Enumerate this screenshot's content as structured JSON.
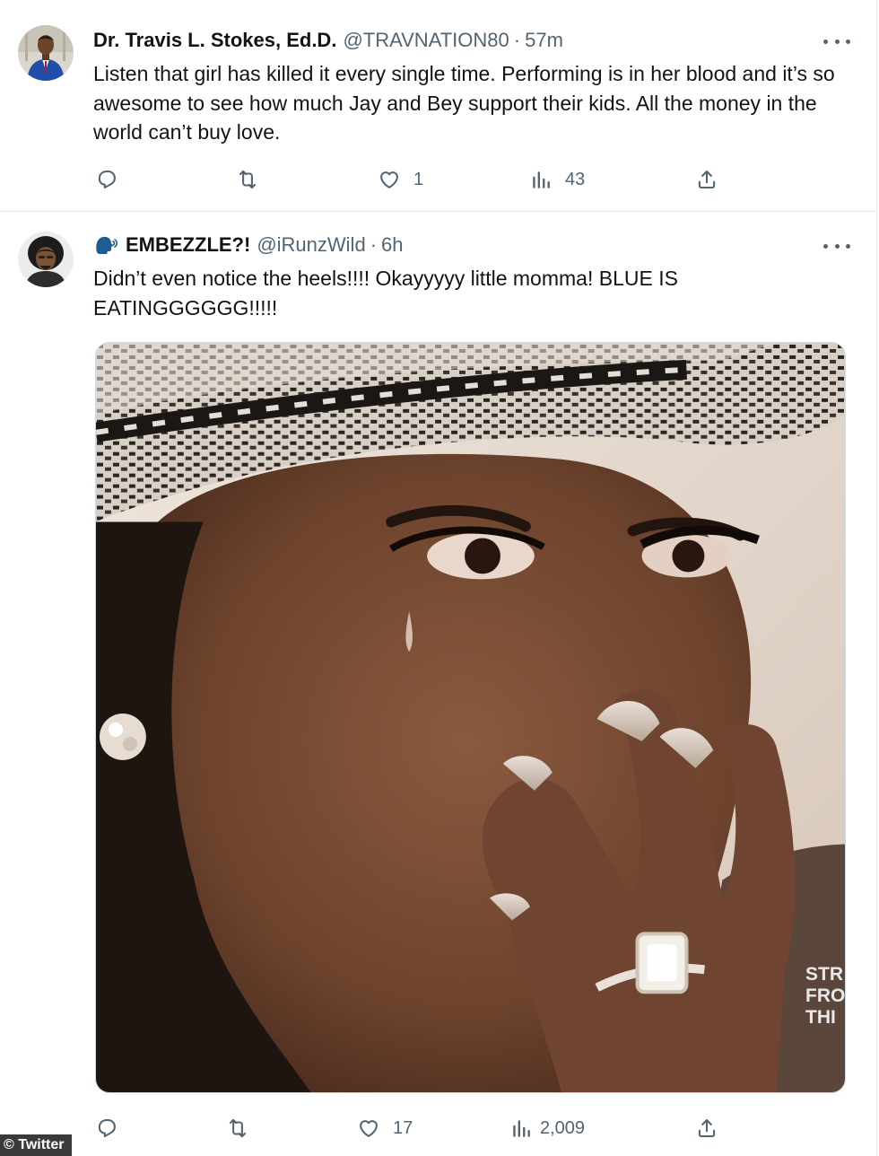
{
  "tweets": [
    {
      "display_name": "Dr. Travis L. Stokes, Ed.D.",
      "handle": "@TRAVNATION80",
      "separator": "·",
      "time": "57m",
      "text": "Listen that girl has killed it every single time. Performing is in her blood and it’s so awesome to see how much Jay and Bey support their kids. All the money in the world can’t buy love.",
      "actions": {
        "reply_count": "",
        "retweet_count": "",
        "like_count": "1",
        "views_count": "43"
      }
    },
    {
      "emoji_icon": "speaking-head-icon",
      "display_name": "EMBEZZLE?!",
      "handle": "@iRunzWild",
      "separator": "·",
      "time": "6h",
      "text": "Didn’t even notice the heels!!!! Okayyyyy little momma! BLUE IS EATINGGGGGG!!!!!",
      "media_watermark": [
        "STR",
        "FRO",
        "THI"
      ],
      "actions": {
        "reply_count": "",
        "retweet_count": "",
        "like_count": "17",
        "views_count": "2,009"
      }
    }
  ],
  "credit": "© Twitter",
  "icons": [
    "reply-icon",
    "retweet-icon",
    "like-icon",
    "views-icon",
    "share-icon",
    "more-icon"
  ],
  "colors": {
    "text": "#0f1419",
    "secondary": "#536471",
    "divider": "#dfe5e9",
    "emoji": "#1d9bf0"
  }
}
